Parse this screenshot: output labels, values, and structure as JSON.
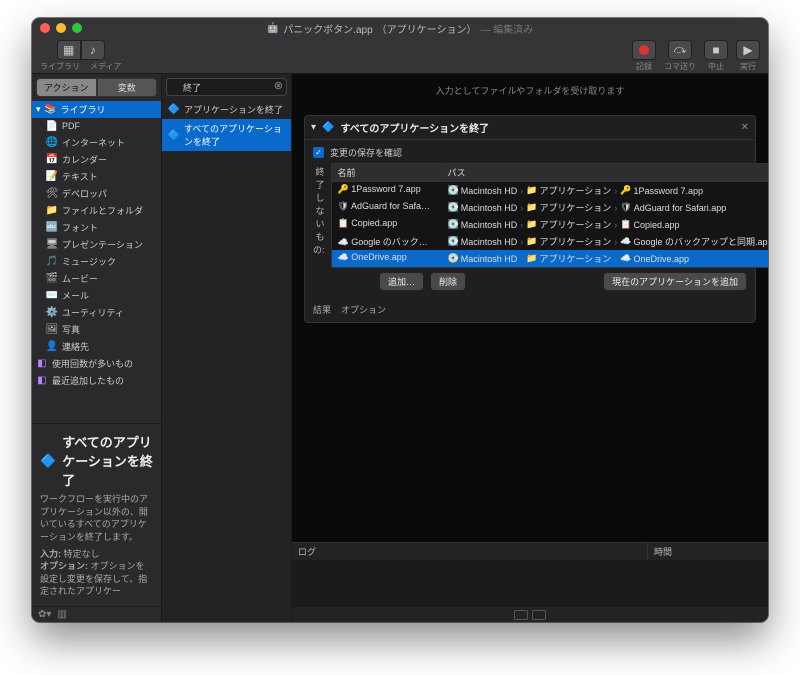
{
  "title": {
    "doc": "パニックボタン.app",
    "type": "（アプリケーション）",
    "status": "— 編集済み"
  },
  "toolbar": {
    "library": "ライブラリ",
    "media": "メディア",
    "record": "記録",
    "step": "コマ送り",
    "stop": "中止",
    "run": "実行"
  },
  "segments": {
    "actions": "アクション",
    "variables": "変数"
  },
  "search": {
    "value": "終了"
  },
  "library_header": "ライブラリ",
  "library_items": [
    {
      "label": "PDF",
      "icon": "📄"
    },
    {
      "label": "インターネット",
      "icon": "🌐"
    },
    {
      "label": "カレンダー",
      "icon": "📅"
    },
    {
      "label": "テキスト",
      "icon": "📝"
    },
    {
      "label": "デベロッパ",
      "icon": "🛠"
    },
    {
      "label": "ファイルとフォルダ",
      "icon": "📁"
    },
    {
      "label": "フォント",
      "icon": "🔤"
    },
    {
      "label": "プレゼンテーション",
      "icon": "🖥"
    },
    {
      "label": "ミュージック",
      "icon": "🎵"
    },
    {
      "label": "ムービー",
      "icon": "🎬"
    },
    {
      "label": "メール",
      "icon": "✉️"
    },
    {
      "label": "ユーティリティ",
      "icon": "⚙️"
    },
    {
      "label": "写真",
      "icon": "🖼"
    },
    {
      "label": "連絡先",
      "icon": "👤"
    }
  ],
  "smart_items": [
    {
      "label": "使用回数が多いもの"
    },
    {
      "label": "最近追加したもの"
    }
  ],
  "results": [
    {
      "label": "アプリケーションを終了",
      "sel": false
    },
    {
      "label": "すべてのアプリケーションを終了",
      "sel": true
    }
  ],
  "drop_hint": "入力としてファイルやフォルダを受け取ります",
  "card": {
    "title": "すべてのアプリケーションを終了",
    "confirm": "変更の保存を確認",
    "exclude_label": "終了しないもの:",
    "cols": {
      "name": "名前",
      "path": "パス"
    },
    "rows": [
      {
        "name": "1Password 7.app",
        "hd": "Macintosh HD",
        "folder": "アプリケーション",
        "app": "1Password 7.app",
        "ic": "🔑",
        "sel": false
      },
      {
        "name": "AdGuard for Safa…",
        "hd": "Macintosh HD",
        "folder": "アプリケーション",
        "app": "AdGuard for Safari.app",
        "ic": "🛡",
        "sel": false
      },
      {
        "name": "Copied.app",
        "hd": "Macintosh HD",
        "folder": "アプリケーション",
        "app": "Copied.app",
        "ic": "📋",
        "sel": false
      },
      {
        "name": "Google のバックア…",
        "hd": "Macintosh HD",
        "folder": "アプリケーション",
        "app": "Google のバックアップと同期.app",
        "ic": "☁️",
        "sel": false
      },
      {
        "name": "OneDrive.app",
        "hd": "Macintosh HD",
        "folder": "アプリケーション",
        "app": "OneDrive.app",
        "ic": "☁️",
        "sel": true
      }
    ],
    "btn_add": "追加…",
    "btn_del": "削除",
    "btn_addcurrent": "現在のアプリケーションを追加",
    "results_link": "結果",
    "options_link": "オプション"
  },
  "desc": {
    "title": "すべてのアプリケーションを終了",
    "body": "ワークフローを実行中のアプリケーション以外の、開いているすべてのアプリケーションを終了します。",
    "input_label": "入力:",
    "input_value": "特定なし",
    "options_label": "オプション:",
    "options_value": "オプションを設定し変更を保存して、指定されたアプリケー"
  },
  "log": {
    "col1": "ログ",
    "col2": "時間"
  }
}
